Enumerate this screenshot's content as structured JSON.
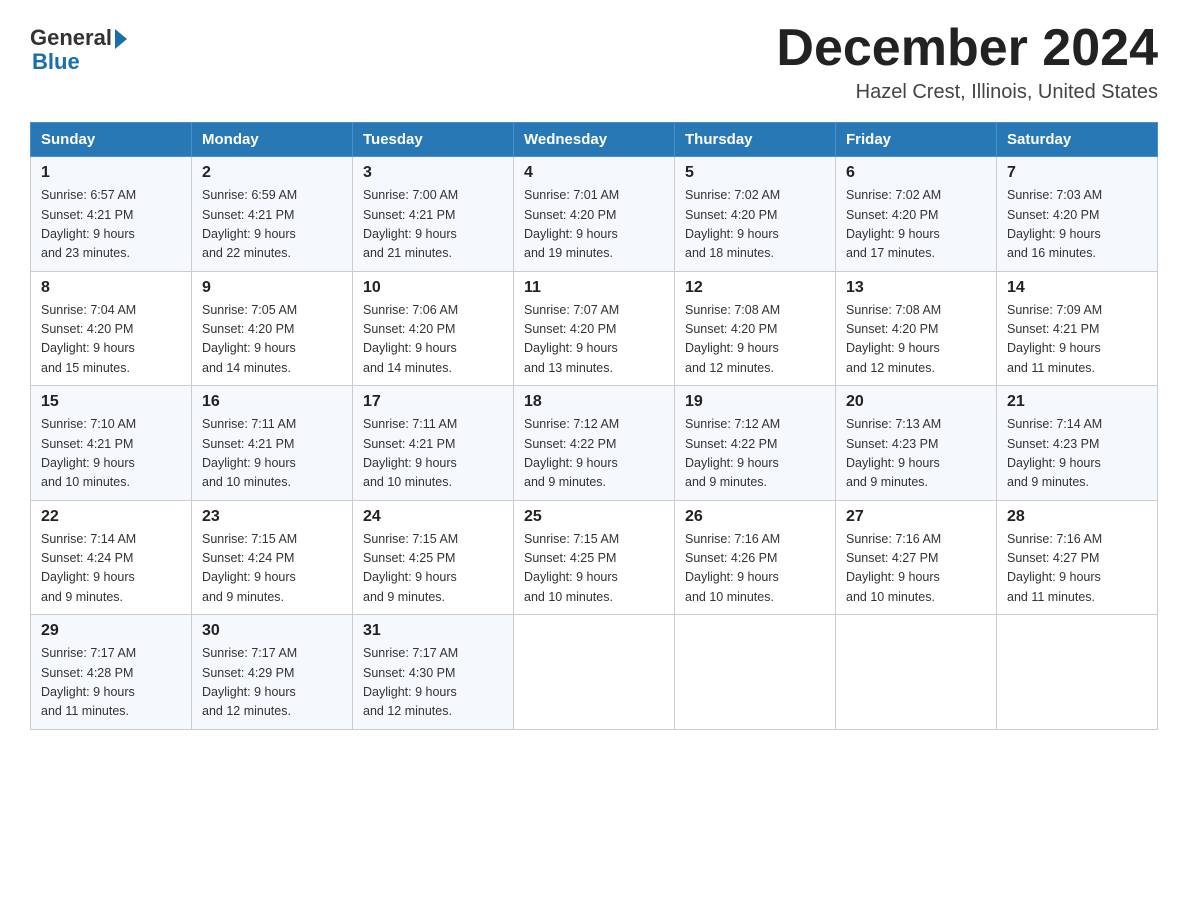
{
  "logo": {
    "general": "General",
    "blue": "Blue"
  },
  "header": {
    "title": "December 2024",
    "location": "Hazel Crest, Illinois, United States"
  },
  "weekdays": [
    "Sunday",
    "Monday",
    "Tuesday",
    "Wednesday",
    "Thursday",
    "Friday",
    "Saturday"
  ],
  "weeks": [
    [
      {
        "day": "1",
        "sunrise": "6:57 AM",
        "sunset": "4:21 PM",
        "daylight": "9 hours and 23 minutes."
      },
      {
        "day": "2",
        "sunrise": "6:59 AM",
        "sunset": "4:21 PM",
        "daylight": "9 hours and 22 minutes."
      },
      {
        "day": "3",
        "sunrise": "7:00 AM",
        "sunset": "4:21 PM",
        "daylight": "9 hours and 21 minutes."
      },
      {
        "day": "4",
        "sunrise": "7:01 AM",
        "sunset": "4:20 PM",
        "daylight": "9 hours and 19 minutes."
      },
      {
        "day": "5",
        "sunrise": "7:02 AM",
        "sunset": "4:20 PM",
        "daylight": "9 hours and 18 minutes."
      },
      {
        "day": "6",
        "sunrise": "7:02 AM",
        "sunset": "4:20 PM",
        "daylight": "9 hours and 17 minutes."
      },
      {
        "day": "7",
        "sunrise": "7:03 AM",
        "sunset": "4:20 PM",
        "daylight": "9 hours and 16 minutes."
      }
    ],
    [
      {
        "day": "8",
        "sunrise": "7:04 AM",
        "sunset": "4:20 PM",
        "daylight": "9 hours and 15 minutes."
      },
      {
        "day": "9",
        "sunrise": "7:05 AM",
        "sunset": "4:20 PM",
        "daylight": "9 hours and 14 minutes."
      },
      {
        "day": "10",
        "sunrise": "7:06 AM",
        "sunset": "4:20 PM",
        "daylight": "9 hours and 14 minutes."
      },
      {
        "day": "11",
        "sunrise": "7:07 AM",
        "sunset": "4:20 PM",
        "daylight": "9 hours and 13 minutes."
      },
      {
        "day": "12",
        "sunrise": "7:08 AM",
        "sunset": "4:20 PM",
        "daylight": "9 hours and 12 minutes."
      },
      {
        "day": "13",
        "sunrise": "7:08 AM",
        "sunset": "4:20 PM",
        "daylight": "9 hours and 12 minutes."
      },
      {
        "day": "14",
        "sunrise": "7:09 AM",
        "sunset": "4:21 PM",
        "daylight": "9 hours and 11 minutes."
      }
    ],
    [
      {
        "day": "15",
        "sunrise": "7:10 AM",
        "sunset": "4:21 PM",
        "daylight": "9 hours and 10 minutes."
      },
      {
        "day": "16",
        "sunrise": "7:11 AM",
        "sunset": "4:21 PM",
        "daylight": "9 hours and 10 minutes."
      },
      {
        "day": "17",
        "sunrise": "7:11 AM",
        "sunset": "4:21 PM",
        "daylight": "9 hours and 10 minutes."
      },
      {
        "day": "18",
        "sunrise": "7:12 AM",
        "sunset": "4:22 PM",
        "daylight": "9 hours and 9 minutes."
      },
      {
        "day": "19",
        "sunrise": "7:12 AM",
        "sunset": "4:22 PM",
        "daylight": "9 hours and 9 minutes."
      },
      {
        "day": "20",
        "sunrise": "7:13 AM",
        "sunset": "4:23 PM",
        "daylight": "9 hours and 9 minutes."
      },
      {
        "day": "21",
        "sunrise": "7:14 AM",
        "sunset": "4:23 PM",
        "daylight": "9 hours and 9 minutes."
      }
    ],
    [
      {
        "day": "22",
        "sunrise": "7:14 AM",
        "sunset": "4:24 PM",
        "daylight": "9 hours and 9 minutes."
      },
      {
        "day": "23",
        "sunrise": "7:15 AM",
        "sunset": "4:24 PM",
        "daylight": "9 hours and 9 minutes."
      },
      {
        "day": "24",
        "sunrise": "7:15 AM",
        "sunset": "4:25 PM",
        "daylight": "9 hours and 9 minutes."
      },
      {
        "day": "25",
        "sunrise": "7:15 AM",
        "sunset": "4:25 PM",
        "daylight": "9 hours and 10 minutes."
      },
      {
        "day": "26",
        "sunrise": "7:16 AM",
        "sunset": "4:26 PM",
        "daylight": "9 hours and 10 minutes."
      },
      {
        "day": "27",
        "sunrise": "7:16 AM",
        "sunset": "4:27 PM",
        "daylight": "9 hours and 10 minutes."
      },
      {
        "day": "28",
        "sunrise": "7:16 AM",
        "sunset": "4:27 PM",
        "daylight": "9 hours and 11 minutes."
      }
    ],
    [
      {
        "day": "29",
        "sunrise": "7:17 AM",
        "sunset": "4:28 PM",
        "daylight": "9 hours and 11 minutes."
      },
      {
        "day": "30",
        "sunrise": "7:17 AM",
        "sunset": "4:29 PM",
        "daylight": "9 hours and 12 minutes."
      },
      {
        "day": "31",
        "sunrise": "7:17 AM",
        "sunset": "4:30 PM",
        "daylight": "9 hours and 12 minutes."
      },
      null,
      null,
      null,
      null
    ]
  ],
  "labels": {
    "sunrise": "Sunrise:",
    "sunset": "Sunset:",
    "daylight": "Daylight:"
  }
}
